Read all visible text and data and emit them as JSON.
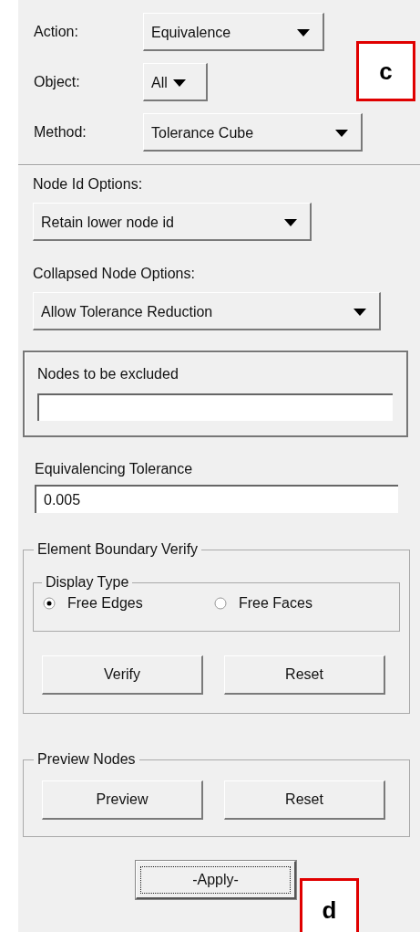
{
  "top_fields": [
    {
      "label": "Action:",
      "value": "Equivalence"
    },
    {
      "label": "Object:",
      "value": "All"
    },
    {
      "label": "Method:",
      "value": "Tolerance Cube"
    }
  ],
  "node_id_options": {
    "label": "Node Id Options:",
    "value": "Retain lower node id"
  },
  "collapsed_node_options": {
    "label": "Collapsed Node Options:",
    "value": "Allow Tolerance Reduction"
  },
  "nodes_excluded": {
    "label": "Nodes to be excluded"
  },
  "tolerance": {
    "label": "Equivalencing Tolerance",
    "value": "0.005"
  },
  "element_boundary_verify": {
    "title": "Element Boundary Verify",
    "display_type": {
      "title": "Display Type",
      "options": [
        {
          "label": "Free Edges",
          "selected": true
        },
        {
          "label": "Free Faces",
          "selected": false
        }
      ]
    },
    "buttons": [
      "Verify",
      "Reset"
    ]
  },
  "preview_nodes": {
    "title": "Preview Nodes",
    "buttons": [
      "Preview",
      "Reset"
    ]
  },
  "apply_button": "-Apply-",
  "annotations": {
    "top": "c",
    "bottom": "d"
  }
}
